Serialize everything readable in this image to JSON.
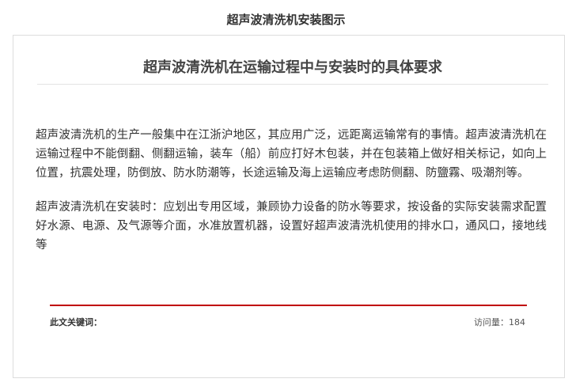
{
  "page": {
    "heading": "超声波清洗机安装图示"
  },
  "article": {
    "title": "超声波清洗机在运输过程中与安装时的具体要求",
    "paragraphs": [
      "超声波清洗机的生产一般集中在江浙沪地区，其应用广泛，远距离运输常有的事情。超声波清洗机在运输过程中不能倒翻、侧翻运输，装车（船）前应打好木包装，并在包装箱上做好相关标记，如向上位置，抗震处理，防倒放、防水防潮等，长途运输及海上运输应考虑防侧翻、防鹽霧、吸潮剂等。",
      "超声波清洗机在安装时：应划出专用区域，兼顾协力设备的防水等要求，按设备的实际安装需求配置好水源、电源、及气源等介面，水准放置机器，设置好超声波清洗机使用的排水口，通风口，接地线等"
    ]
  },
  "footer": {
    "keywords_label": "此文关键词：",
    "visits_label": "访问量：",
    "visits_count": "184"
  }
}
